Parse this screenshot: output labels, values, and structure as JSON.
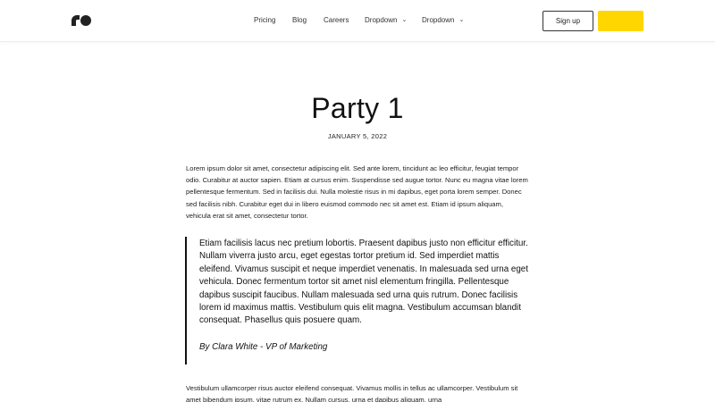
{
  "navbar": {
    "links": [
      {
        "label": "Pricing"
      },
      {
        "label": "Blog"
      },
      {
        "label": "Careers"
      },
      {
        "label": "Dropdown"
      },
      {
        "label": "Dropdown"
      }
    ],
    "signup_label": "Sign up",
    "cta_label": ""
  },
  "post": {
    "title": "Party 1",
    "date": "JANUARY 5, 2022",
    "intro": "Lorem ipsum dolor sit amet, consectetur adipiscing elit. Sed ante lorem, tincidunt ac leo efficitur, feugiat tempor odio. Curabitur at auctor sapien. Etiam at cursus enim. Suspendisse sed augue tortor. Nunc eu magna vitae lorem pellentesque fermentum. Sed in facilisis dui. Nulla molestie risus in mi dapibus, eget porta lorem semper. Donec sed facilisis nibh. Curabitur eget dui in libero euismod commodo nec sit amet est. Etiam id ipsum aliquam, vehicula erat sit amet, consectetur tortor.",
    "quote": "Etiam facilisis lacus nec pretium lobortis. Praesent dapibus justo non efficitur efficitur. Nullam viverra justo arcu, eget egestas tortor pretium id. Sed imperdiet mattis eleifend. Vivamus suscipit et neque imperdiet venenatis. In malesuada sed urna eget vehicula. Donec fermentum tortor sit amet nisl elementum fringilla. Pellentesque dapibus suscipit faucibus. Nullam malesuada sed urna quis rutrum. Donec facilisis lorem id maximus mattis. Vestibulum quis elit magna. Vestibulum accumsan blandit consequat. Phasellus quis posuere quam.",
    "quote_author": "By Clara White - VP of Marketing",
    "body": "Vestibulum ullamcorper risus auctor eleifend consequat. Vivamus mollis in tellus ac ullamcorper. Vestibulum sit amet bibendum ipsum, vitae rutrum ex. Nullam cursus, urna et dapibus aliquam, urna"
  },
  "colors": {
    "accent": "#ffd600",
    "text": "#111111",
    "border": "#ececec"
  },
  "icons": {
    "logo": "ro-logo-icon",
    "dropdown": "chevron-down-icon"
  }
}
